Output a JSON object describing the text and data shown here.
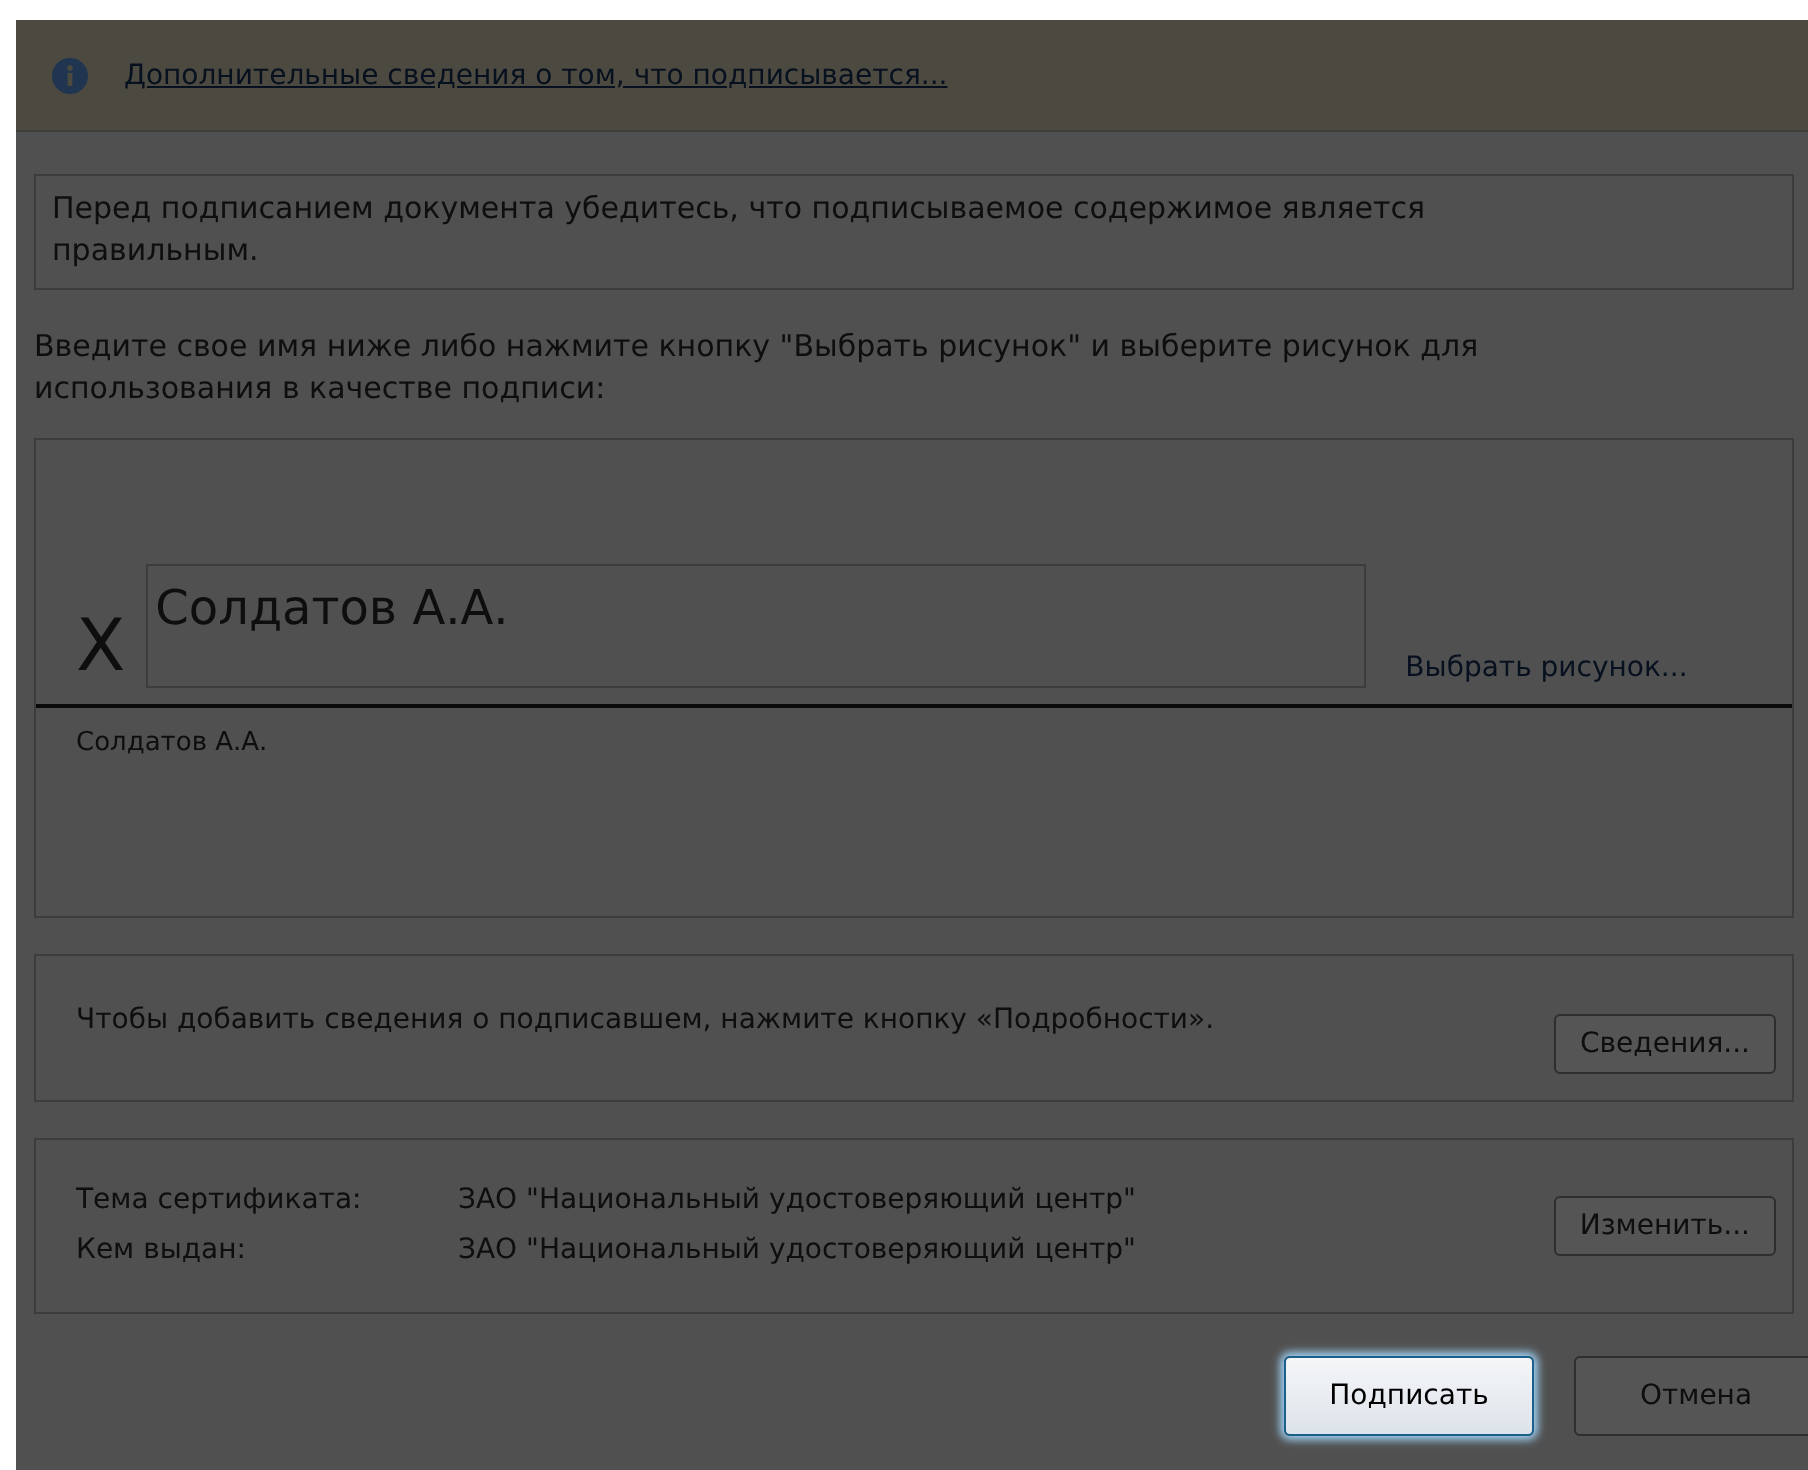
{
  "info_bar": {
    "link": "Дополнительные сведения о том, что подписывается..."
  },
  "warning": "Перед подписанием документа убедитесь, что подписываемое содержимое является правильным.",
  "instruction": {
    "text": "Введите свое имя ниже либо нажмите кнопку \"Выбрать рисунок\" и выберите рисунок для использования в качестве подписи:"
  },
  "signature": {
    "mark": "X",
    "value": "Солдатов А.А.",
    "picture_link": "Выбрать рисунок...",
    "signer": "Солдатов А.А."
  },
  "details": {
    "text": "Чтобы добавить сведения о подписавшем, нажмите кнопку «Подробности».",
    "button": {
      "label": "Сведения..."
    }
  },
  "certificate": {
    "rows": [
      {
        "label": "Тема сертификата:",
        "value": "ЗАО \"Национальный удостоверяющий центр\""
      },
      {
        "label": "Кем выдан:",
        "value": "ЗАО \"Национальный удостоверяющий центр\""
      }
    ],
    "button": {
      "label": "Изменить..."
    }
  },
  "buttons": [
    {
      "label": "Подписать",
      "default": true
    },
    {
      "label": "Отмена",
      "default": false
    }
  ]
}
